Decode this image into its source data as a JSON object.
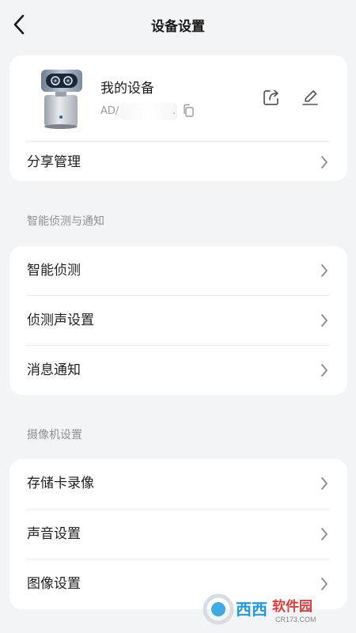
{
  "header": {
    "title": "设备设置",
    "back_icon": "chevron-left-icon"
  },
  "device": {
    "name": "我的设备",
    "id_prefix": "AD/",
    "id_suffix": ".",
    "share_icon": "share-icon",
    "edit_icon": "edit-pencil-icon",
    "copy_icon": "copy-icon",
    "share_manage_label": "分享管理"
  },
  "sections": [
    {
      "title": "智能侦测与通知",
      "items": [
        "智能侦测",
        "侦测声设置",
        "消息通知"
      ]
    },
    {
      "title": "摄像机设置",
      "items": [
        "存储卡录像",
        "声音设置",
        "图像设置"
      ]
    }
  ],
  "watermark": {
    "brand": "西西软件园",
    "url": "CR173.COM"
  },
  "colors": {
    "background": "#f3f4f6",
    "card": "#ffffff",
    "text": "#1f1f1f",
    "secondary_text": "#8e9095",
    "chevron": "#8a8a8e"
  }
}
